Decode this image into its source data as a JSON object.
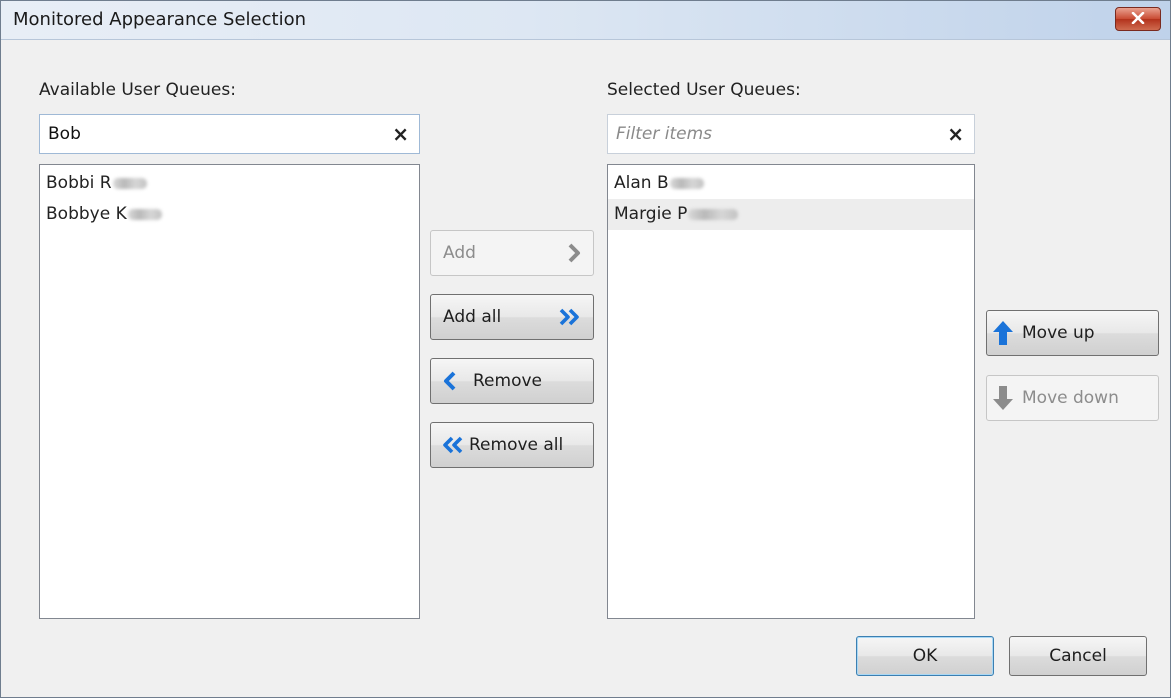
{
  "window": {
    "title": "Monitored Appearance Selection"
  },
  "available": {
    "label": "Available User Queues:",
    "search_value": "Bob",
    "clear_glyph": "×",
    "items": [
      "Bobbi R",
      "Bobbye K"
    ]
  },
  "selected": {
    "label": "Selected User Queues:",
    "filter_placeholder": "Filter items",
    "clear_glyph": "×",
    "items": [
      "Alan B",
      "Margie P"
    ]
  },
  "transfer": {
    "add_label": "Add",
    "add_all_label": "Add all",
    "remove_label": "Remove",
    "remove_all_label": "Remove all"
  },
  "order": {
    "move_up_label": "Move up",
    "move_down_label": "Move down"
  },
  "footer": {
    "ok_label": "OK",
    "cancel_label": "Cancel"
  },
  "icons": {
    "close": "close-icon",
    "add": "chevron-right-icon",
    "add_all": "double-chevron-right-icon",
    "remove": "chevron-left-icon",
    "remove_all": "double-chevron-left-icon",
    "move_up": "arrow-up-icon",
    "move_down": "arrow-down-icon"
  },
  "colors": {
    "accent_blue": "#1a73d9",
    "disabled_gray": "#8c8c8c",
    "close_red": "#c84a32"
  }
}
